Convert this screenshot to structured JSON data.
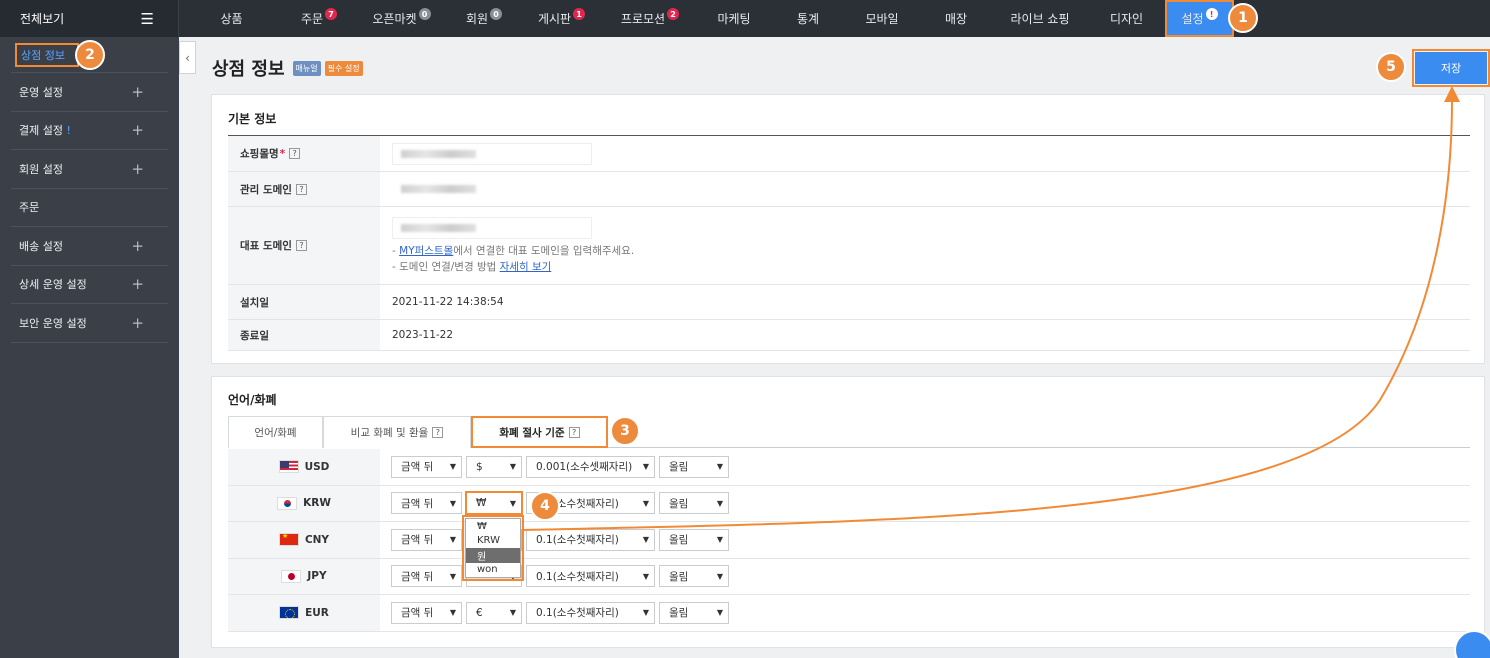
{
  "brand": {
    "label": "전체보기",
    "menu_icon": "hamburger-icon"
  },
  "topnav": [
    {
      "label": "상품",
      "badge": ""
    },
    {
      "label": "주문",
      "badge": "7"
    },
    {
      "label": "오픈마켓",
      "badge": "0"
    },
    {
      "label": "회원",
      "badge": "0"
    },
    {
      "label": "게시판",
      "badge": "1"
    },
    {
      "label": "프로모션",
      "badge": "2"
    },
    {
      "label": "마케팅",
      "badge": ""
    },
    {
      "label": "통계",
      "badge": ""
    },
    {
      "label": "모바일",
      "badge": ""
    },
    {
      "label": "매장",
      "badge": ""
    },
    {
      "label": "라이브 쇼핑",
      "badge": ""
    },
    {
      "label": "디자인",
      "badge": ""
    },
    {
      "label": "설정",
      "badge": "!"
    }
  ],
  "sidebar": {
    "items": [
      {
        "label": "상점 정보",
        "plus": ""
      },
      {
        "label": "운영 설정",
        "plus": "+"
      },
      {
        "label": "결제 설정",
        "warn": "!",
        "plus": "+"
      },
      {
        "label": "회원 설정",
        "plus": "+"
      },
      {
        "label": "주문",
        "plus": ""
      },
      {
        "label": "배송 설정",
        "plus": "+"
      },
      {
        "label": "상세 운영 설정",
        "plus": "+"
      },
      {
        "label": "보안 운영 설정",
        "plus": "+"
      }
    ]
  },
  "page": {
    "title": "상점 정보",
    "tag_manual": "매뉴얼",
    "tag_required": "필수 설정",
    "save_label": "저장"
  },
  "basic": {
    "title": "기본 정보",
    "shop_name_label": "쇼핑몰명",
    "required_mark": "*",
    "admin_domain_label": "관리 도메인",
    "main_domain_label": "대표 도메인",
    "help1_link": "MY퍼스트몰",
    "help1_text": "에서 연결한 대표 도메인을 입력해주세요.",
    "help1_prefix": "- ",
    "help2_prefix": "- 도메인 연결/변경 방법 ",
    "help2_link": "자세히 보기",
    "install_label": "설치일",
    "install_value": "2021-11-22 14:38:54",
    "end_label": "종료일",
    "end_value": "2023-11-22",
    "help_mark": "?"
  },
  "currency": {
    "title": "언어/화폐",
    "tabs": [
      "언어/화폐",
      "비교 화폐 및 환율",
      "화폐 절사 기준"
    ],
    "rows": [
      {
        "code": "USD",
        "flag": "us-flag-icon",
        "pos": "금액 뒤",
        "symbol": "$",
        "precision": "0.001(소수셋째자리)",
        "round": "올림"
      },
      {
        "code": "KRW",
        "flag": "kr-flag-icon",
        "pos": "금액 뒤",
        "symbol": "₩",
        "precision": "0.1(소수첫째자리)",
        "round": "올림"
      },
      {
        "code": "CNY",
        "flag": "cn-flag-icon",
        "pos": "금액 뒤",
        "symbol": "",
        "precision": "0.1(소수첫째자리)",
        "round": "올림"
      },
      {
        "code": "JPY",
        "flag": "jp-flag-icon",
        "pos": "금액 뒤",
        "symbol": "",
        "precision": "0.1(소수첫째자리)",
        "round": "올림"
      },
      {
        "code": "EUR",
        "flag": "eu-flag-icon",
        "pos": "금액 뒤",
        "symbol": "€",
        "precision": "0.1(소수첫째자리)",
        "round": "올림"
      }
    ],
    "dropdown_options": [
      "₩",
      "KRW",
      "원",
      "won"
    ],
    "dropdown_selected": "원"
  },
  "callouts": [
    "1",
    "2",
    "3",
    "4",
    "5"
  ],
  "colors": {
    "accent": "#3b8cf0",
    "highlight": "#f28a35",
    "badge": "#e0284f",
    "sidebar": "#3a3f48"
  }
}
